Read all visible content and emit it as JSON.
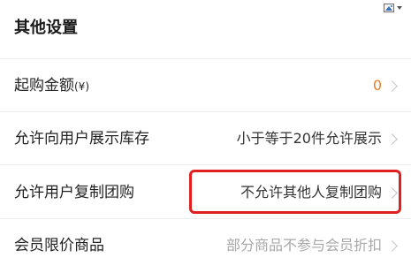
{
  "header": {
    "title": "其他设置",
    "corner_icon": "image-icon"
  },
  "rows": [
    {
      "label": "起购金额",
      "label_suffix": "(¥)",
      "value": "0",
      "value_color": "#f07c2a"
    },
    {
      "label": "允许向用户展示库存",
      "value": "小于等于20件允许展示",
      "value_color": "#333333"
    },
    {
      "label": "允许用户复制团购",
      "value": "不允许其他人复制团购",
      "value_color": "#333333",
      "highlighted": true
    },
    {
      "label": "会员限价商品",
      "value": "部分商品不参与会员折扣",
      "value_color": "#a8a8a8"
    }
  ],
  "colors": {
    "accent": "#f07c2a",
    "highlight_border": "#e02020",
    "divider": "#ececec"
  }
}
